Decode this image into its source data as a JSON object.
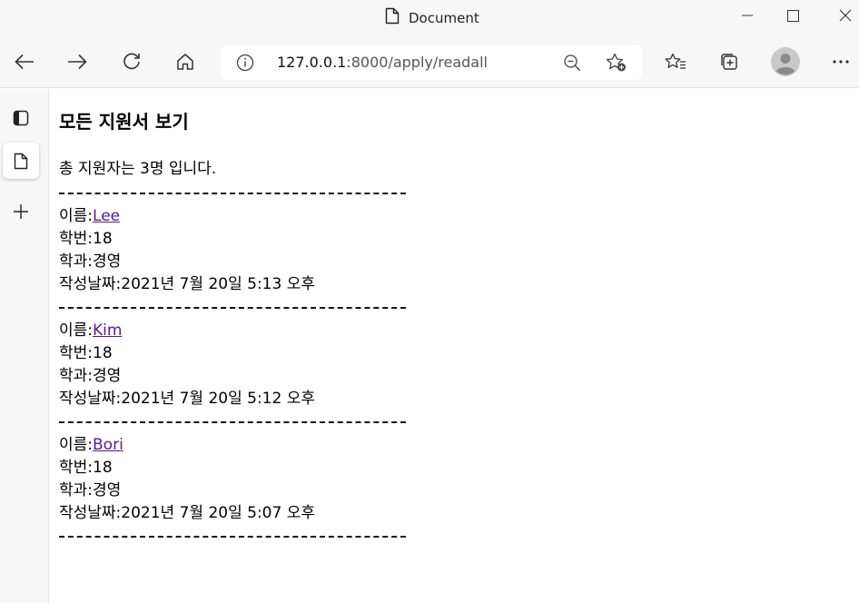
{
  "window": {
    "title": "Document"
  },
  "address": {
    "host": "127.0.0.1",
    "path": ":8000/apply/readall"
  },
  "page": {
    "heading": "모든 지원서 보기",
    "summary": "총 지원자는 3명 입니다.",
    "labels": {
      "name": "이름:",
      "id": "학번:",
      "dept": "학과:",
      "date": "작성날짜:"
    },
    "entries": [
      {
        "name": "Lee",
        "student_id": "18",
        "department": "경영",
        "created": "2021년 7월 20일 5:13 오후"
      },
      {
        "name": "Kim",
        "student_id": "18",
        "department": "경영",
        "created": "2021년 7월 20일 5:12 오후"
      },
      {
        "name": "Bori",
        "student_id": "18",
        "department": "경영",
        "created": "2021년 7월 20일 5:07 오후"
      }
    ]
  },
  "colors": {
    "visited_link": "#551a8b",
    "chrome_bg": "#f7f7f7"
  }
}
